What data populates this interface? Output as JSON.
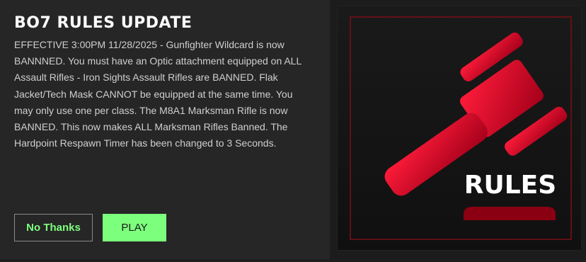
{
  "dialog": {
    "title": "BO7 RULES UPDATE",
    "body": "EFFECTIVE 3:00PM 11/28/2025 - Gunfighter Wildcard is now BANNNED. You must have an Optic attachment equipped on ALL Assault Rifles - Iron Sights Assault Rifles are BANNED. Flak Jacket/Tech Mask CANNOT be equipped at the same time. You may only use one per class. The M8A1 Marksman Rifle is now BANNED. This now makes ALL Marksman Rifles Banned. The Hardpoint Respawn Timer has been changed to 3 Seconds.",
    "buttons": {
      "decline_label": "No Thanks",
      "play_label": "PLAY"
    }
  },
  "image": {
    "label": "RULES",
    "icon": "gavel-icon",
    "accent_color": "#d3001f",
    "border_color": "#7a0f17"
  },
  "colors": {
    "panel_bg": "#262626",
    "play_button_bg": "#7cff7c",
    "decline_text": "#7dff7d",
    "body_text": "#cfcfcf"
  }
}
